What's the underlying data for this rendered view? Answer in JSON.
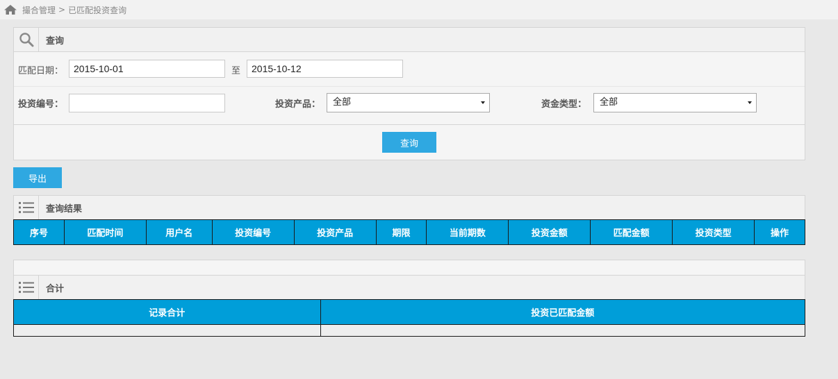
{
  "breadcrumb": {
    "root": "撮合管理",
    "separator": ">",
    "current": "已匹配投资查询"
  },
  "query_panel": {
    "title": "查询",
    "match_date_label": "匹配日期：",
    "date_from": "2015-10-01",
    "to_label": "至",
    "date_to": "2015-10-12",
    "invest_no_label": "投资编号：",
    "invest_no_value": "",
    "product_label": "投资产品：",
    "product_value": "全部",
    "fund_type_label": "资金类型：",
    "fund_type_value": "全部",
    "query_button": "查询"
  },
  "export_button": "导出",
  "results": {
    "title": "查询结果",
    "columns": [
      "序号",
      "匹配时间",
      "用户名",
      "投资编号",
      "投资产品",
      "期限",
      "当前期数",
      "投资金额",
      "匹配金额",
      "投资类型",
      "操作"
    ]
  },
  "summary": {
    "title": "合计",
    "columns": [
      "记录合计",
      "投资已匹配金额"
    ]
  },
  "colors": {
    "accent": "#2fa8e1",
    "header_blue": "#009ed9",
    "background": "#e8e8e8"
  }
}
